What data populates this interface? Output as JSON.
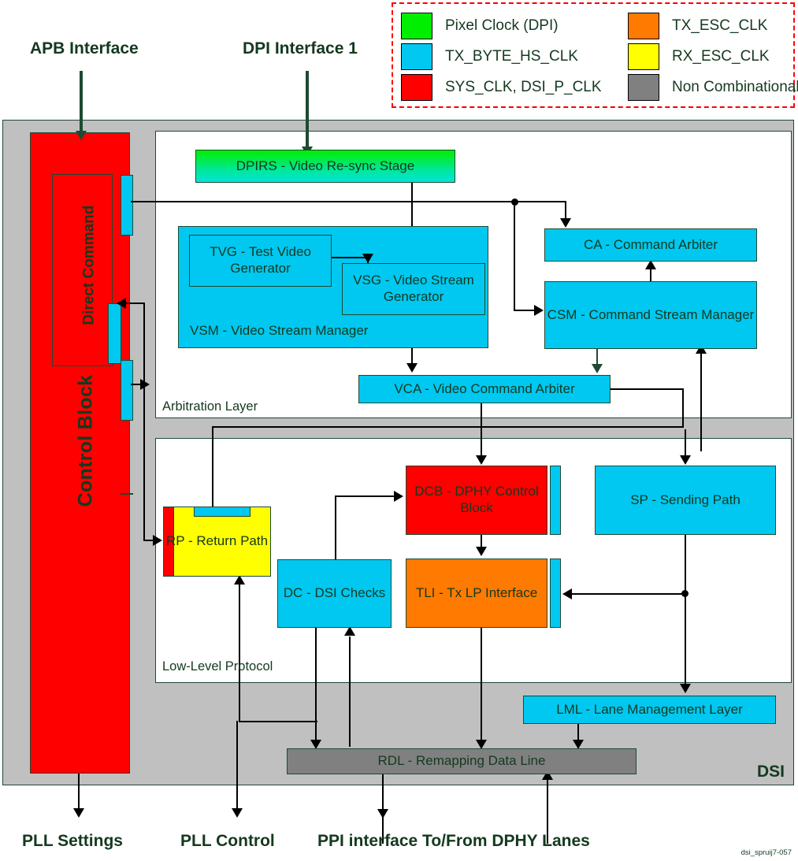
{
  "legend": {
    "title": "clock-domain-legend",
    "items": [
      {
        "label": "Pixel Clock (DPI)",
        "color": "#00ee00"
      },
      {
        "label": "TX_ESC_CLK",
        "color": "#ff7a00"
      },
      {
        "label": "TX_BYTE_HS_CLK",
        "color": "#00c8f0"
      },
      {
        "label": "RX_ESC_CLK",
        "color": "#ffff00"
      },
      {
        "label": "SYS_CLK, DSI_P_CLK",
        "color": "#fe0000"
      },
      {
        "label": "Non Combinational",
        "color": "#808080"
      }
    ]
  },
  "interfaces": {
    "apb": "APB Interface",
    "dpi": "DPI Interface 1"
  },
  "container": {
    "dsi_tag": "DSI"
  },
  "layers": {
    "arbitration": "Arbitration Layer",
    "low_level": "Low-Level Protocol"
  },
  "blocks": {
    "control_block": "Control Block",
    "direct_command": "Direct Command",
    "dpirs": "DPIRS - Video Re-sync Stage",
    "vsm": "VSM - Video Stream Manager",
    "tvg": "TVG - Test Video Generator",
    "vsg": "VSG - Video Stream Generator",
    "ca": "CA - Command Arbiter",
    "csm": "CSM - Command Stream Manager",
    "vca": "VCA - Video Command Arbiter",
    "rp": "RP - Return Path",
    "dc": "DC - DSI Checks",
    "dcb": "DCB - DPHY Control Block",
    "tli": "TLI - Tx LP Interface",
    "sp": "SP - Sending Path",
    "lml": "LML - Lane Management Layer",
    "rdl": "RDL - Remapping Data Line"
  },
  "outputs": {
    "pll_settings": "PLL Settings",
    "pll_control": "PLL Control",
    "ppi": "PPI interface To/From DPHY Lanes"
  },
  "watermark": "dsi_spruij7-057"
}
